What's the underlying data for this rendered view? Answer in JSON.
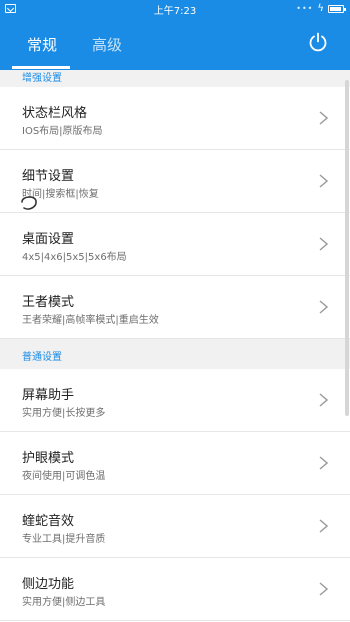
{
  "status_bar": {
    "time": "上午7:23",
    "left_icon": "screenshot-icon",
    "right_icons": [
      "signal-dots-icon",
      "charging-bolt-icon",
      "battery-icon"
    ]
  },
  "tabs": [
    {
      "label": "常规",
      "active": true
    },
    {
      "label": "高级",
      "active": false
    }
  ],
  "header": {
    "power_icon": "power-icon",
    "accent": "#1a8ce6"
  },
  "sections": [
    {
      "title": "增强设置",
      "items": [
        {
          "title": "状态栏风格",
          "subtitle": "IOS布局|原版布局"
        },
        {
          "title": "细节设置",
          "subtitle": "时间|搜索框|恢复"
        },
        {
          "title": "桌面设置",
          "subtitle": "4x5|4x6|5x5|5x6布局"
        },
        {
          "title": "王者模式",
          "subtitle": "王者荣耀|高帧率模式|重启生效"
        }
      ]
    },
    {
      "title": "普通设置",
      "items": [
        {
          "title": "屏幕助手",
          "subtitle": "实用方便|长按更多"
        },
        {
          "title": "护眼模式",
          "subtitle": "夜间使用|可调色温"
        },
        {
          "title": "蝰蛇音效",
          "subtitle": "专业工具|提升音质"
        },
        {
          "title": "侧边功能",
          "subtitle": "实用方便|侧边工具"
        }
      ]
    }
  ]
}
